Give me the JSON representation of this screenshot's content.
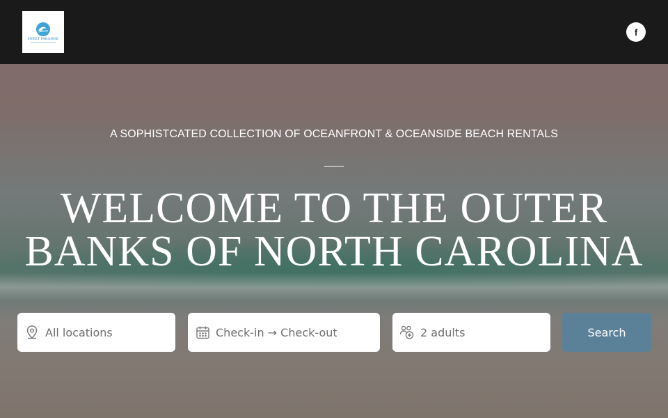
{
  "header": {
    "logo_text": "SWEET PARADISE",
    "social_facebook": "f"
  },
  "hero": {
    "tagline": "A SOPHISTCATED COLLECTION OF OCEANFRONT & OCEANSIDE BEACH RENTALS",
    "headline_line1": "WELCOME TO THE OUTER",
    "headline_line2": "BANKS OF NORTH CAROLINA"
  },
  "search": {
    "location_label": "All locations",
    "dates_label": "Check-in → Check-out",
    "guests_label": "2 adults",
    "button_label": "Search"
  },
  "colors": {
    "topbar": "#1a1a1a",
    "search_button": "#5b8199",
    "logo_accent": "#2a7fb8"
  }
}
